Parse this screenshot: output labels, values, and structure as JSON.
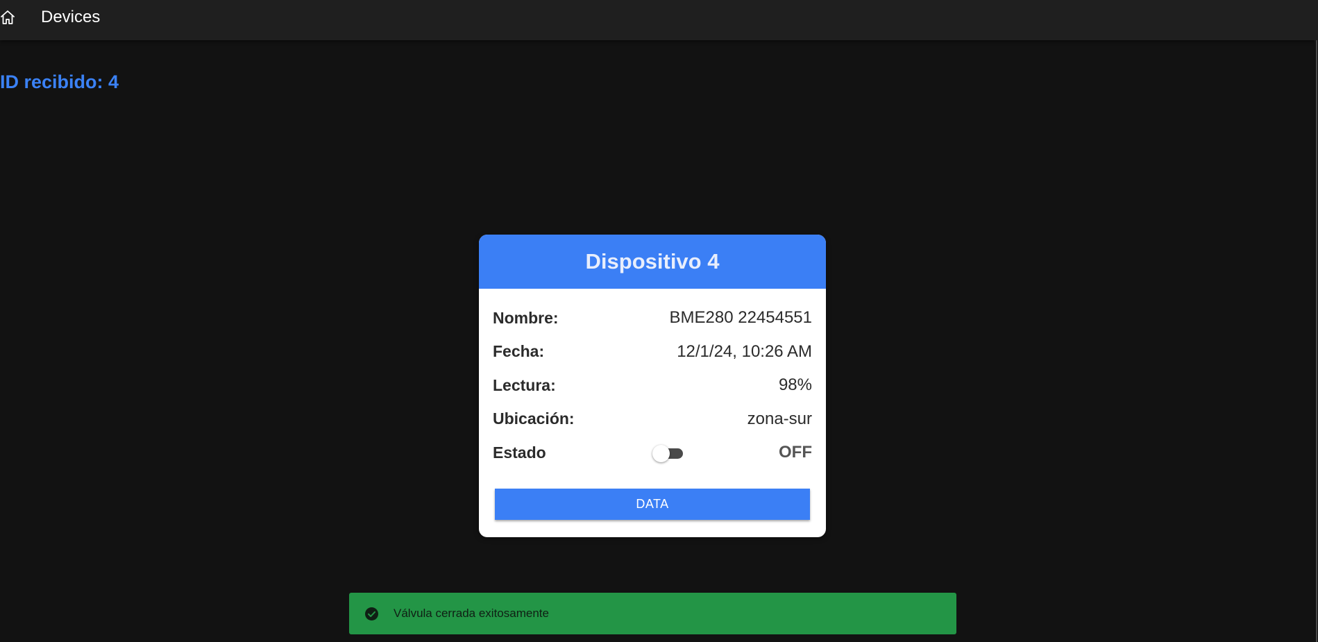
{
  "toolbar": {
    "home_icon": "home-icon",
    "title": "Devices"
  },
  "heading": {
    "text": "ID recibido: 4"
  },
  "card": {
    "title": "Dispositivo 4",
    "rows": [
      {
        "label": "Nombre:",
        "value": "BME280 22454551"
      },
      {
        "label": "Fecha:",
        "value": "12/1/24, 10:26 AM"
      },
      {
        "label": "Lectura:",
        "value": "98%"
      },
      {
        "label": "Ubicación:",
        "value": "zona-sur"
      },
      {
        "label": "Estado",
        "value": "OFF"
      }
    ],
    "toggle_on": false,
    "button_label": "DATA"
  },
  "snackbar": {
    "icon": "check-circle-icon",
    "message": "Válvula cerrada exitosamente"
  },
  "colors": {
    "accent": "#3b7ff5",
    "success": "#239546",
    "background": "#121212",
    "toolbar": "#1f1f1f"
  }
}
